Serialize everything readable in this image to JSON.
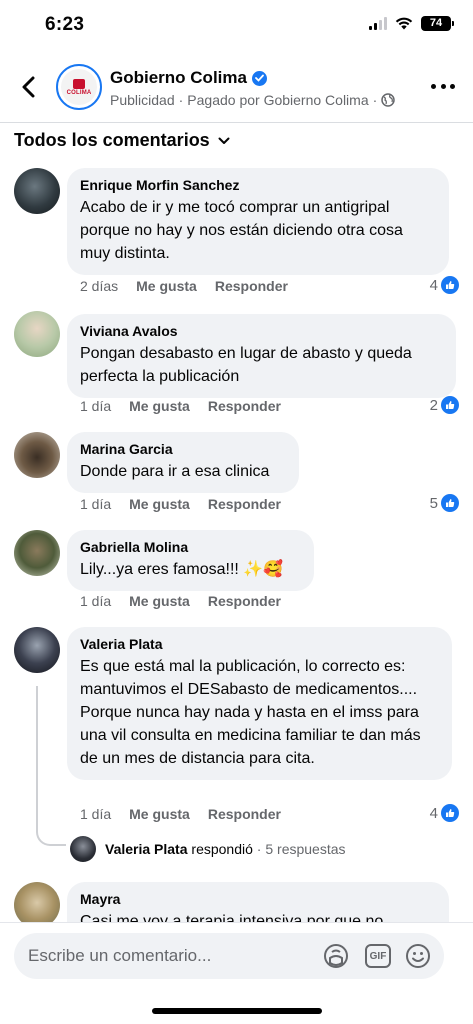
{
  "status_bar": {
    "time": "6:23",
    "battery": "74"
  },
  "header": {
    "page_name": "Gobierno Colima",
    "avatar_text": "COLIMA",
    "meta_sponsored": "Publicidad",
    "meta_separator": "·",
    "meta_paid": "Pagado por Gobierno Colima",
    "meta_separator2": "·"
  },
  "filter": {
    "label": "Todos los comentarios"
  },
  "comments": [
    {
      "name": "Enrique Morfin Sanchez",
      "text": "Acabo de ir y me tocó comprar un antigripal porque no hay y nos están diciendo otra cosa muy distinta.",
      "time": "2 días",
      "like": "Me gusta",
      "reply": "Responder",
      "reactions": "4"
    },
    {
      "name": "Viviana Avalos",
      "text": "Pongan desabasto en lugar de abasto y queda perfecta la publicación",
      "time": "1 día",
      "like": "Me gusta",
      "reply": "Responder",
      "reactions": "2"
    },
    {
      "name": "Marina Garcia",
      "text": "Donde para ir a esa clinica",
      "time": "1 día",
      "like": "Me gusta",
      "reply": "Responder",
      "reactions": "5"
    },
    {
      "name": "Gabriella Molina",
      "text": "Lily...ya eres famosa!!! ✨🥰",
      "time": "1 día",
      "like": "Me gusta",
      "reply": "Responder"
    },
    {
      "name": "Valeria Plata",
      "text": "Es que está mal la publicación, lo correcto es: mantuvimos el DESabasto de medicamentos.... Porque nunca hay nada y hasta en el imss para una vil consulta en medicina familiar te dan más de un mes de distancia para cita.",
      "time": "1 día",
      "like": "Me gusta",
      "reply": "Responder",
      "reactions": "4",
      "reply_summary": {
        "who": "Valeria Plata",
        "action": "respondió",
        "separator": "·",
        "count": "5 respuestas"
      }
    },
    {
      "name": "Mayra",
      "text": "Casi me voy a terapia intensiva por que no"
    }
  ],
  "composer": {
    "placeholder": "Escribe un comentario...",
    "gif_label": "GIF"
  }
}
